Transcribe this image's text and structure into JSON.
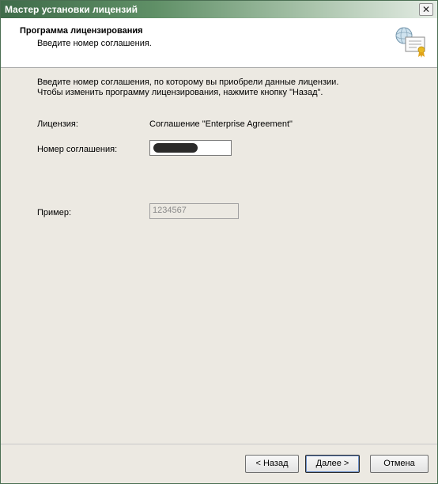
{
  "window": {
    "title": "Мастер установки лицензий"
  },
  "header": {
    "title": "Программа лицензирования",
    "subtitle": "Введите номер соглашения.",
    "icon": "license-certificate-icon"
  },
  "content": {
    "instructions_line1": "Введите номер соглашения, по которому вы приобрели данные лицензии.",
    "instructions_line2": "Чтобы изменить программу лицензирования, нажмите кнопку \"Назад\".",
    "license_label": "Лицензия:",
    "license_value": "Соглашение \"Enterprise Agreement\"",
    "agreement_number_label": "Номер соглашения:",
    "agreement_number_value": "",
    "example_label": "Пример:",
    "example_value": "1234567"
  },
  "buttons": {
    "back": "< Назад",
    "next": "Далее >",
    "cancel": "Отмена"
  }
}
